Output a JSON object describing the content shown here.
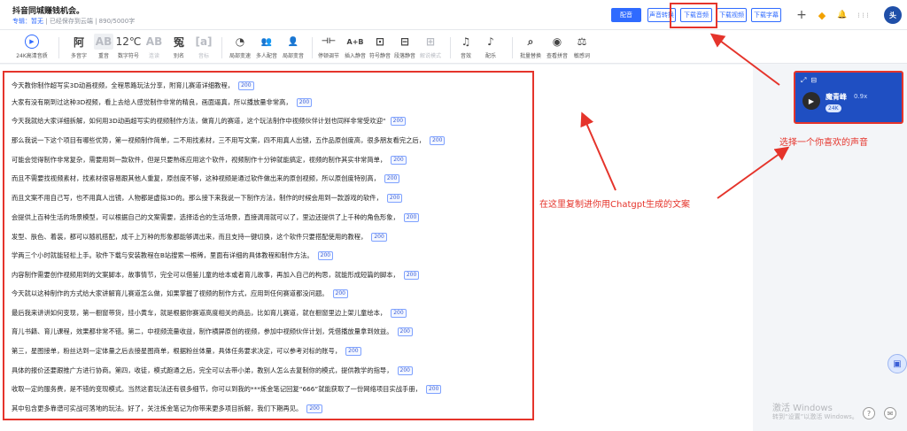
{
  "header": {
    "title": "抖音同城赚钱机会。",
    "mode_label": "专辑：暂无",
    "saved_text": "已经保存到云端",
    "word_count": "890/5000字",
    "btn_dubbing": "配音",
    "btn_voice_transfer": "声音转换",
    "btn_download_audio": "下载音频",
    "btn_download_video": "下载视频",
    "btn_download_subtitle": "下载字幕",
    "icon_add": "+",
    "icon_vip": "◆",
    "icon_bell": "🔔",
    "icon_apps": "⋮⋮⋮",
    "avatar_text": "头"
  },
  "toolbar": {
    "items": [
      {
        "icon": "▶",
        "label": "24K高清音质"
      },
      {
        "icon": "阿",
        "label": "多音字"
      },
      {
        "icon": "AB",
        "label": "重音"
      },
      {
        "icon": "12℃",
        "label": "数字符号"
      },
      {
        "icon": "AB",
        "label": "连读"
      },
      {
        "icon": "冤",
        "label": "别名"
      },
      {
        "icon": "[a]",
        "label": "音标"
      },
      {
        "icon": "◔",
        "label": "局部变速"
      },
      {
        "icon": "👥",
        "label": "多人配音"
      },
      {
        "icon": "👤",
        "label": "局部变音"
      },
      {
        "icon": "⊣⊢",
        "label": "停顿调节"
      },
      {
        "icon": "A+B",
        "label": "插入静音"
      },
      {
        "icon": "⊡",
        "label": "符号静音"
      },
      {
        "icon": "⊟",
        "label": "段落静音"
      },
      {
        "icon": "⊞",
        "label": "解说模式"
      },
      {
        "icon": "♫",
        "label": "音效"
      },
      {
        "icon": "♪",
        "label": "配乐"
      },
      {
        "icon": "⌕",
        "label": "批量替换"
      },
      {
        "icon": "◉",
        "label": "查看拼音"
      },
      {
        "icon": "⚖",
        "label": "敏感词"
      }
    ]
  },
  "editor": {
    "badge": "200",
    "lines": [
      "今天教你制作超写实3D动画视频，全程思路玩法分享，附育儿赛道详细教程，",
      "大家有没有刷到过这种3D视频，看上去给人感觉制作非常的精良，画面逼真，所以播放量非常高，",
      "今天我就给大家详细拆解，如何用3D动画超写实的视频制作方法，做育儿的赛道，这个玩法制作中视频伙伴计划也同样非常受欢迎“",
      "那么我说一下这个项目有哪些优势，第一视频制作简单，二不用找素材，三不用写文案，四不用真人出镜，五作品原创度高，很多朋友看完之后，",
      "可能会觉得制作非常复杂，需要用到一款软件，但是只要熟练应用这个软件，视频制作十分钟就能搞定，视频的制作其实非常简单，",
      "而且不需要找视频素材，找素材很容易跟其他人重复，原创度不够，这种视频是通过软件做出来的原创视频，所以原创度特别高，",
      "而且文案不用自己写，也不用真人出镜，人物都是虚拟3D的。那么接下来我说一下制作方法，制作的时候会用到一款游戏的软件，",
      "会提供上百种生活的场景模型，可以根据自己的文案需要，选择适合的生活场景，直接调用就可以了，里边还提供了上千种的角色形象，",
      "发型、肤色、着装，都可以随机搭配，成千上万种的形象都能够调出来，而且支持一键切换，这个软件只要搭配使用的教程，",
      "学两三个小时就能轻松上手。软件下载与安装教程在B站搜索一根稀，里面有详细的具体教程和制作方法。",
      "内容制作需要创作视频用到的文案脚本，故事情节，完全可以借鉴儿童的绘本或者育儿故事，再加入自己的构思，就能形成短篇的脚本，",
      "今天就以这种制作的方式给大家讲解育儿赛道怎么做，如果掌握了视频的制作方式，应用到任何赛道都没问题。",
      "最后我来讲讲如何变现，第一橱窗带货，挂小黄车，就是根据你赛道高度相关的商品，比如育儿赛道，就在橱窗里边上架儿童绘本，",
      "育儿书籍、育儿课程，效果都非常不错。第二，中视频流量收益，制作横屏原创的视频，参加中视频伙伴计划，凭借播放量拿到效益。",
      "第三，星图接单，粉丝达到一定体量之后去接星图商单，根据粉丝体量，具体任务要求决定，可以参考对标的账号，",
      "具体的报价还要跟推广方进行协商。第四，收徒，模式跑通之后，完全可以去带小弟，教别人怎么去复制你的模式，提供教学的指导，",
      "收取一定的服务费，是不错的变现模式。当然这套玩法还有很多细节，你可以到我的***炼金笔记回复“666”就能获取了一份网络项目实战手册，",
      "其中包含更多靠谱可实战可落地的玩法。好了，关注炼金笔记为你带来更多项目拆解，我们下期再见。"
    ]
  },
  "annotations": {
    "paste_hint": "在这里复制进你用Chatgpt生成的文案",
    "voice_hint": "选择一个你喜欢的声音"
  },
  "voice_card": {
    "expand_icon": "⤢",
    "minimize_icon": "⊟",
    "avatar": "▶",
    "name": "魔青峰",
    "speed": "0.9x",
    "quality_tag": "24K"
  },
  "watermark": {
    "line1": "激活 Windows",
    "line2": "转到“设置”以激活 Windows。"
  },
  "colors": {
    "accent": "#2f6bff",
    "annotation_red": "#e5342b",
    "card_bg": "#1f4fc2"
  }
}
